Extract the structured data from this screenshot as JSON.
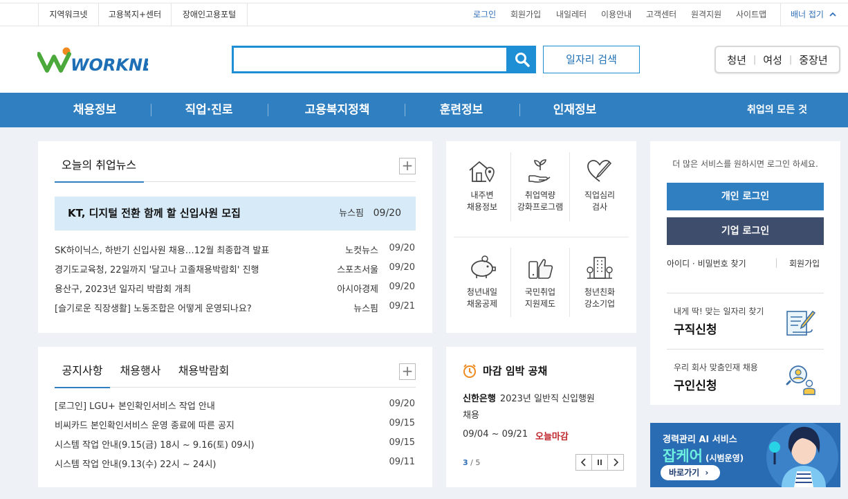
{
  "topbar": {
    "left_links": [
      "지역워크넷",
      "고용복지+센터",
      "장애인고용포털"
    ],
    "right_links": [
      "로그인",
      "회원가입",
      "내일레터",
      "이용안내",
      "고객센터",
      "원격지원",
      "사이트맵"
    ],
    "banner_toggle": "배너 접기"
  },
  "header": {
    "logo_text": "WORKNET",
    "search_placeholder": "",
    "job_search_label": "일자리 검색",
    "targets": [
      "청년",
      "여성",
      "중장년"
    ]
  },
  "gnb": {
    "items": [
      "채용정보",
      "직업·진로",
      "고용복지정책",
      "훈련정보",
      "인재정보"
    ],
    "all_label": "취업의 모든 것"
  },
  "news": {
    "tab": "오늘의 취업뉴스",
    "more": "+",
    "featured": {
      "title": "KT, 디지털 전환 함께 할 신입사원 모집",
      "source": "뉴스핌",
      "date": "09/20"
    },
    "items": [
      {
        "title": "SK하이닉스, 하반기 신입사원 채용…12월 최종합격 발표",
        "source": "노컷뉴스",
        "date": "09/20"
      },
      {
        "title": "경기도교육청, 22일까지 '달고나 고졸채용박람회' 진행",
        "source": "스포츠서울",
        "date": "09/20"
      },
      {
        "title": "용산구, 2023년 일자리 박람회 개최",
        "source": "아시아경제",
        "date": "09/20"
      },
      {
        "title": "[슬기로운 직장생활] 노동조합은 어떻게 운영되나요?",
        "source": "뉴스핌",
        "date": "09/21"
      }
    ]
  },
  "services": {
    "row1": [
      {
        "label1": "내주변",
        "label2": "채용정보",
        "icon": "house-location-icon"
      },
      {
        "label1": "취업역량",
        "label2": "강화프로그램",
        "icon": "hand-plant-icon"
      },
      {
        "label1": "직업심리",
        "label2": "검사",
        "icon": "heart-pen-icon"
      }
    ],
    "row2": [
      {
        "label1": "청년내일",
        "label2": "채움공제",
        "icon": "piggy-bank-icon"
      },
      {
        "label1": "국민취업",
        "label2": "지원제도",
        "icon": "thumbs-up-icon"
      },
      {
        "label1": "청년친화",
        "label2": "강소기업",
        "icon": "building-icon"
      }
    ]
  },
  "login": {
    "notice": "더 많은 서비스를 원하시면 로그인 하세요.",
    "personal": "개인 로그인",
    "company": "기업 로그인",
    "find": "아이디 · 비밀번호 찾기",
    "join": "회원가입",
    "job_seek_sub": "내게 딱! 맞는 일자리 찾기",
    "job_seek_title": "구직신청",
    "hire_sub": "우리 회사 맞춤인재 채용",
    "hire_title": "구인신청",
    "colors": {
      "personal": "#2f7fc1",
      "company": "#3e4d6c"
    }
  },
  "notices": {
    "tabs": [
      "공지사항",
      "채용행사",
      "채용박람회"
    ],
    "more": "+",
    "items": [
      {
        "title": "[로그인] LGU+ 본인확인서비스 작업 안내",
        "date": "09/20"
      },
      {
        "title": "비씨카드 본인확인서비스 운영 종료에 따른 공지",
        "date": "09/15"
      },
      {
        "title": "시스템 작업 안내(9.15(금) 18시 ~ 9.16(토) 09시)",
        "date": "09/15"
      },
      {
        "title": "시스템 작업 안내(9.13(수) 22시 ~ 24시)",
        "date": "09/11"
      }
    ]
  },
  "deadline": {
    "title": "마감 임박 공채",
    "company": "신한은행",
    "desc1": "2023년 일반직 신입행원",
    "desc2": "채용",
    "period": "09/04 ~ 09/21",
    "status": "오늘마감",
    "page_current": "3",
    "page_sep": "/",
    "page_total": "5"
  },
  "ad": {
    "line1": "경력관리 AI 서비스",
    "line2": "잡케어",
    "line2_suffix": "(시범운영)",
    "cta": "바로가기"
  }
}
